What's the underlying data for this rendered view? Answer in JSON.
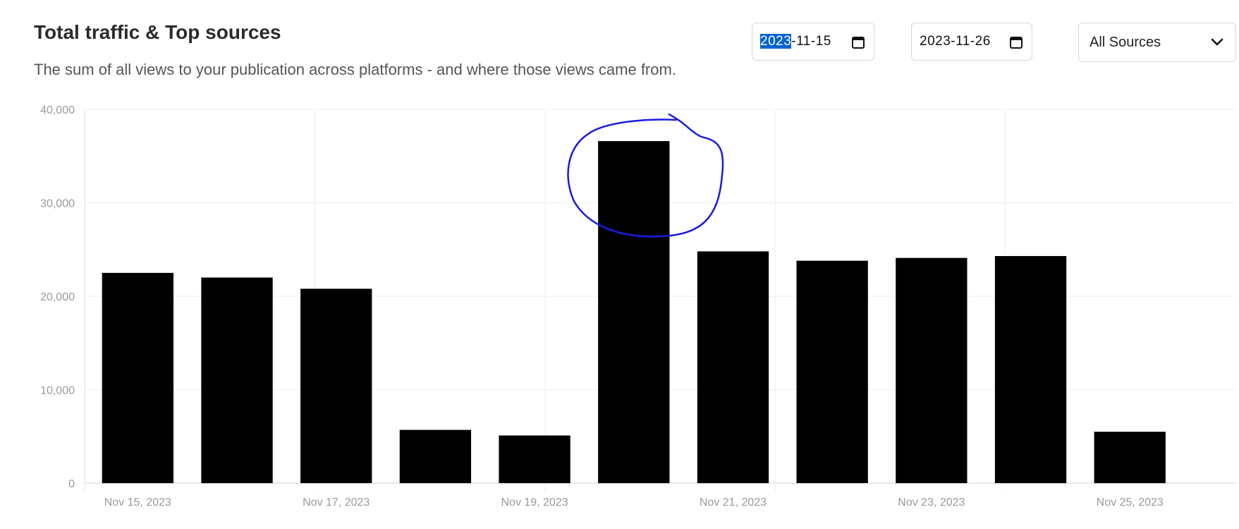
{
  "header": {
    "title": "Total traffic & Top sources",
    "subtitle": "The sum of all views to your publication across platforms - and where those views came from."
  },
  "filters": {
    "start_date": {
      "year": "2023",
      "rest": "-11-15"
    },
    "end_date": "2023-11-26",
    "source_select": "All Sources"
  },
  "icons": {
    "calendar": "calendar-icon",
    "dropdown": "chevron-down-icon"
  },
  "colors": {
    "bar": "#000000",
    "annotation": "#1a1ae0",
    "grid": "#eeeeee",
    "selection": "#0063d3"
  },
  "chart_data": {
    "type": "bar",
    "categories": [
      "Nov 15, 2023",
      "Nov 16, 2023",
      "Nov 17, 2023",
      "Nov 18, 2023",
      "Nov 19, 2023",
      "Nov 20, 2023",
      "Nov 21, 2023",
      "Nov 22, 2023",
      "Nov 23, 2023",
      "Nov 24, 2023",
      "Nov 25, 2023",
      "Nov 26, 2023"
    ],
    "values": [
      22500,
      22000,
      20800,
      5700,
      5100,
      36600,
      24800,
      23800,
      24100,
      24300,
      5500,
      0
    ],
    "x_tick_labels": [
      "Nov 15, 2023",
      "Nov 17, 2023",
      "Nov 19, 2023",
      "Nov 21, 2023",
      "Nov 23, 2023",
      "Nov 25, 2023"
    ],
    "y_ticks": [
      0,
      10000,
      20000,
      30000,
      40000
    ],
    "y_tick_labels": [
      "0",
      "10,000",
      "20,000",
      "30,000",
      "40,000"
    ],
    "ylim": [
      0,
      40000
    ],
    "grid": true,
    "annotation": {
      "type": "hand-drawn circle",
      "target": "Nov 20, 2023"
    }
  }
}
